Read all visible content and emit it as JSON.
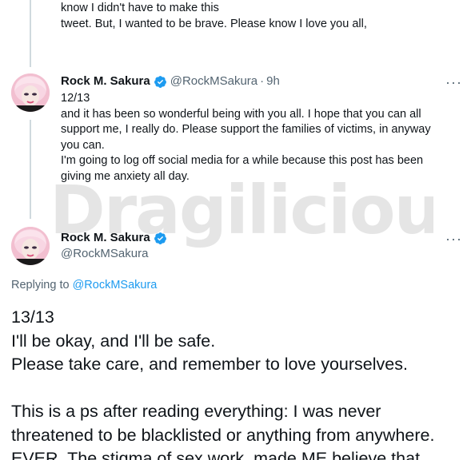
{
  "previous_tweet": {
    "text": "know I didn't have to make this\ntweet. But, I wanted to be brave. Please know I love you all,"
  },
  "tweet_12": {
    "display_name": "Rock M. Sakura",
    "handle": "@RockMSakura",
    "separator": "·",
    "time": "9h",
    "more": "···",
    "text": "12/13\n and it has been so wonderful being with you all. I hope that you can all\nsupport me, I really do. Please support the families of victims, in anyway\nyou can.\nI'm going to log off social media for a while because this post has been\ngiving me anxiety all day."
  },
  "watermark": {
    "text": "Dragilicious"
  },
  "main_tweet": {
    "display_name": "Rock M. Sakura",
    "handle": "@RockMSakura",
    "more": "···",
    "replying_prefix": "Replying to ",
    "replying_to": "@RockMSakura",
    "text": "13/13\nI'll be okay, and I'll be safe.\nPlease take care, and remember to love yourselves.\n\nThis is a ps after reading everything: I was never\nthreatened to be blacklisted or anything from anywhere.\nEVER. The stigma of sex work, made ME believe that"
  },
  "colors": {
    "verified": "#1d9bf0",
    "link": "#1d9bf0",
    "secondary_text": "#536471",
    "thread_line": "#cfd9de"
  },
  "icons": {
    "verified": "verified-badge-icon",
    "more": "more-horizontal-icon"
  }
}
